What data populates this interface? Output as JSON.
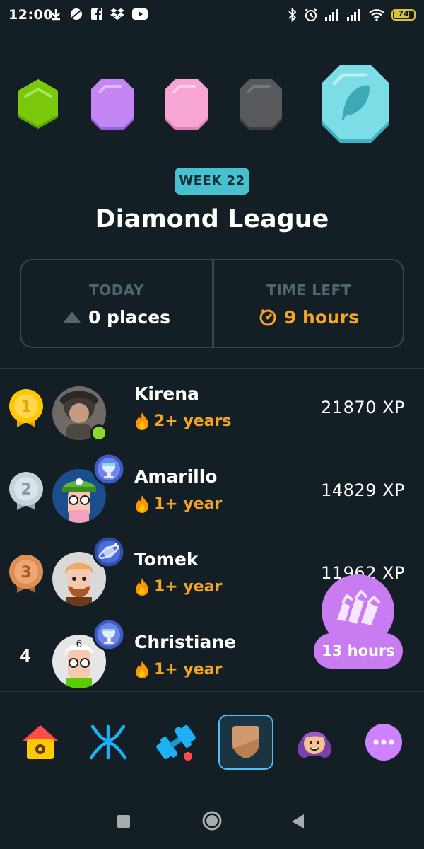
{
  "status_bar": {
    "time": "12:00",
    "battery": "74"
  },
  "league": {
    "badges": [
      "green-league-badge",
      "purple-league-badge",
      "pink-league-badge",
      "gray-league-badge",
      "diamond-league-badge"
    ],
    "week": "WEEK 22",
    "title": "Diamond League"
  },
  "stats": {
    "today_label": "TODAY",
    "today_value": "0 places",
    "time_left_label": "TIME LEFT",
    "time_left_value": "9 hours"
  },
  "leaderboard": [
    {
      "rank": "1",
      "name": "Kirena",
      "streak": "2+ years",
      "xp": "21870 XP",
      "medal": "gold"
    },
    {
      "rank": "2",
      "name": "Amarillo",
      "streak": "1+ year",
      "xp": "14829 XP",
      "medal": "silver"
    },
    {
      "rank": "3",
      "name": "Tomek",
      "streak": "1+ year",
      "xp": "11962 XP",
      "medal": "bronze"
    },
    {
      "rank": "4",
      "name": "Christiane",
      "streak": "1+ year",
      "xp": "",
      "medal": "none"
    }
  ],
  "promo": {
    "label": "13 hours"
  },
  "tabs": [
    "home",
    "characters",
    "practice",
    "leagues",
    "profile",
    "more"
  ],
  "colors": {
    "background": "#131f24",
    "border": "#37464f",
    "muted": "#52656d",
    "accent_orange": "#f5a524",
    "week_pill": "#49c0d0",
    "promo_purple": "#c97cf2",
    "active_tab": "#49c0f8"
  }
}
